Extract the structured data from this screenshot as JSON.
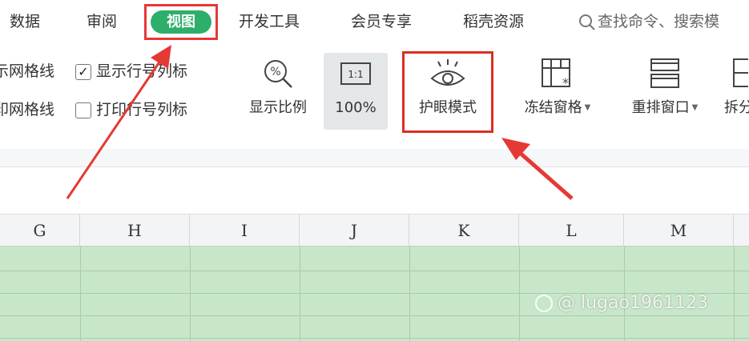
{
  "menu": {
    "items": [
      "数据",
      "审阅",
      "视图",
      "开发工具",
      "会员专享",
      "稻壳资源"
    ],
    "active": "视图",
    "search_placeholder": "查找命令、搜索模"
  },
  "ribbon": {
    "checkboxes": [
      {
        "label": "示网格线",
        "checked": null
      },
      {
        "label": "显示行号列标",
        "checked": true
      },
      {
        "label": "印网格线",
        "checked": null
      },
      {
        "label": "打印行号列标",
        "checked": false
      }
    ],
    "tools": {
      "zoom_label": "显示比例",
      "hundred_icon_text": "1:1",
      "hundred_label": "100%",
      "eye_label": "护眼模式",
      "freeze_label": "冻结窗格",
      "arrange_label": "重排窗口",
      "split_label": "拆分"
    }
  },
  "sheet": {
    "columns": [
      "G",
      "H",
      "I",
      "J",
      "K",
      "L",
      "M"
    ],
    "cell_color": "#c8e6c9"
  },
  "watermark": "@ lugao1961123",
  "colors": {
    "accent": "#2eae6b",
    "highlight": "#e53935",
    "grid": "#c8e6c9"
  }
}
